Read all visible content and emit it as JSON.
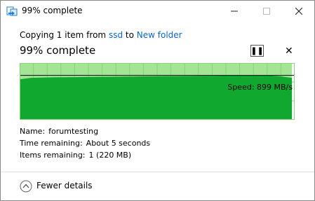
{
  "window": {
    "title": "99% complete",
    "minimize_icon": "minimize-icon",
    "maximize_icon": "maximize-icon",
    "close_icon": "close-icon"
  },
  "copy": {
    "prefix": "Copying 1 item from",
    "source": "ssd",
    "to_word": "to",
    "destination": "New folder",
    "percent_text": "99% complete",
    "progress_fraction": 0.99
  },
  "controls": {
    "pause_icon": "pause-icon",
    "pause_glyph": "❚❚",
    "cancel_icon": "close-icon",
    "cancel_glyph": "✕"
  },
  "speed": {
    "label": "Speed: 899 MB/s",
    "graph_values_mbps": [
      820,
      850,
      855,
      860,
      862,
      865,
      868,
      870,
      872,
      875,
      878,
      880,
      882,
      885,
      886,
      888,
      890,
      892,
      894,
      895,
      897,
      898,
      899,
      880,
      850
    ],
    "current_mbps": 899,
    "max_mbps": 1150
  },
  "details": {
    "name_label": "Name:",
    "name_value": "forumtesting",
    "time_label": "Time remaining:",
    "time_value": "About 5 seconds",
    "items_label": "Items remaining:",
    "items_value": "1 (220 MB)"
  },
  "footer": {
    "toggle_label": "Fewer details",
    "toggle_icon": "chevron-up-circle-icon"
  },
  "colors": {
    "graph_fill": "#10a82f",
    "graph_background": "#a3e594",
    "graph_grid": "#7dd86c",
    "link": "#0b65c1"
  }
}
